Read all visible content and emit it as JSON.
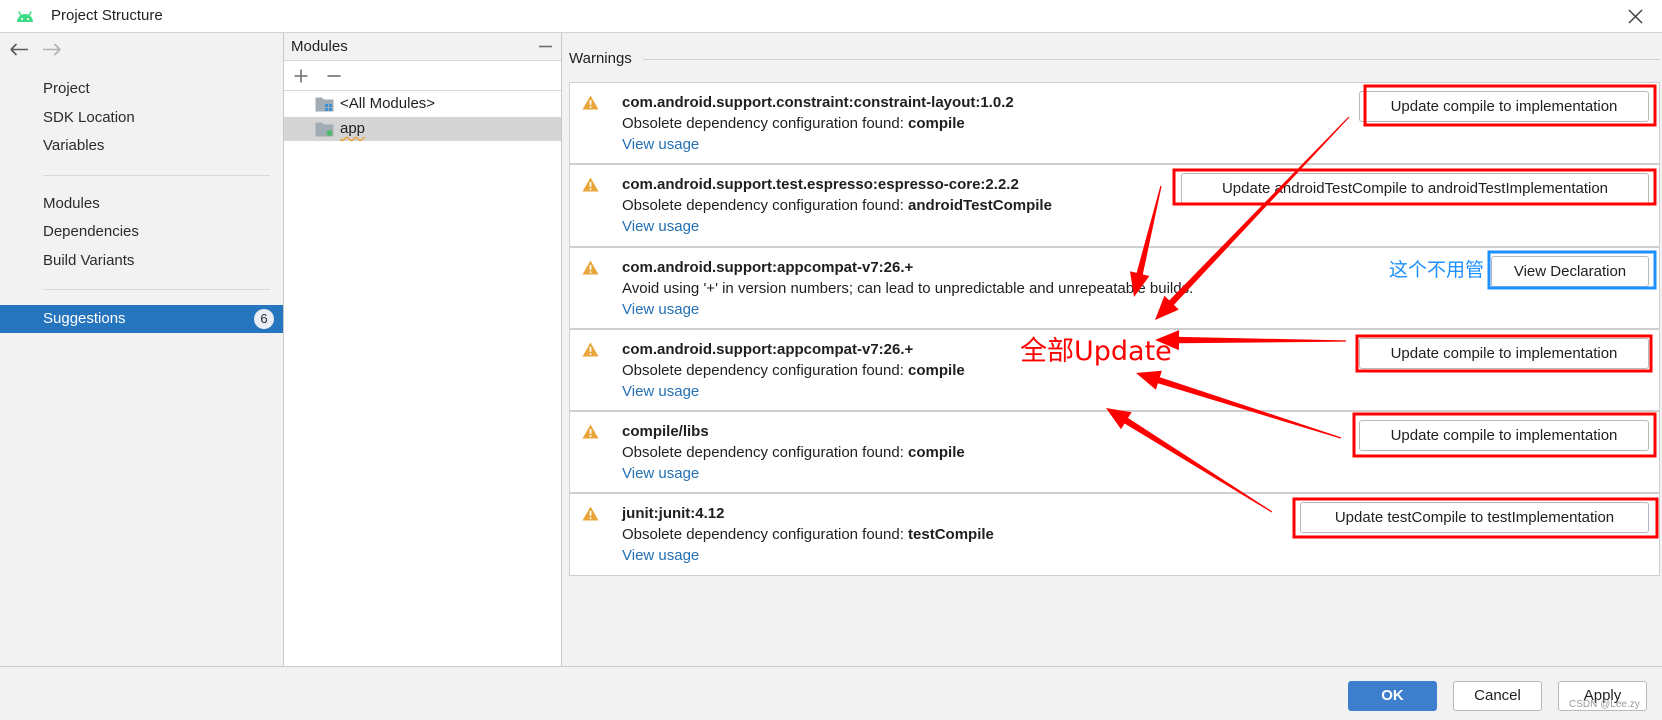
{
  "window": {
    "title": "Project Structure",
    "icon": "android-icon",
    "close_icon": "close-icon"
  },
  "colors": {
    "accent": "#2675bf",
    "link": "#2470b3",
    "warning": "#e8a33d",
    "ok_button": "#3d7fcc",
    "annotation_red": "#ff0000",
    "annotation_blue": "#1e90ff"
  },
  "sidebar": {
    "back_icon": "arrow-left-icon",
    "forward_icon": "arrow-right-icon",
    "items": [
      "Project",
      "SDK Location",
      "Variables",
      "Modules",
      "Dependencies",
      "Build Variants"
    ],
    "suggestions": {
      "label": "Suggestions",
      "count": "6"
    }
  },
  "modules_panel": {
    "header": "Modules",
    "collapse_icon": "minus-icon",
    "add_icon": "plus-icon",
    "remove_icon": "minus-icon",
    "tree": [
      {
        "label": "<All Modules>",
        "icon": "modules-folder-icon"
      },
      {
        "label": "app",
        "icon": "module-folder-icon"
      }
    ]
  },
  "warnings": {
    "title": "Warnings",
    "icon": "warning-icon",
    "items": [
      {
        "title": "com.android.support.constraint:constraint-layout:1.0.2",
        "message": "Obsolete dependency configuration found: ",
        "message_bold": "compile",
        "link": "View usage",
        "action": "Update compile to implementation"
      },
      {
        "title": "com.android.support.test.espresso:espresso-core:2.2.2",
        "message": "Obsolete dependency configuration found: ",
        "message_bold": "androidTestCompile",
        "link": "View usage",
        "action": "Update androidTestCompile to androidTestImplementation"
      },
      {
        "title": "com.android.support:appcompat-v7:26.+",
        "message": "Avoid using '+' in version numbers; can lead to unpredictable and unrepeatable builds.",
        "link": "View usage",
        "action": "View Declaration"
      },
      {
        "title": "com.android.support:appcompat-v7:26.+",
        "message": "Obsolete dependency configuration found: ",
        "message_bold": "compile",
        "link": "View usage",
        "action": "Update compile to implementation"
      },
      {
        "title": "compile/libs",
        "message": "Obsolete dependency configuration found: ",
        "message_bold": "compile",
        "link": "View usage",
        "action": "Update compile to implementation"
      },
      {
        "title": "junit:junit:4.12",
        "message": "Obsolete dependency configuration found: ",
        "message_bold": "testCompile",
        "link": "View usage",
        "action": "Update testCompile to testImplementation"
      }
    ]
  },
  "annotations": {
    "update_all": "全部Update",
    "ignore_this": "这个不用管"
  },
  "footer": {
    "ok": "OK",
    "cancel": "Cancel",
    "apply": "Apply",
    "watermark": "CSDN @Lee.zy"
  }
}
